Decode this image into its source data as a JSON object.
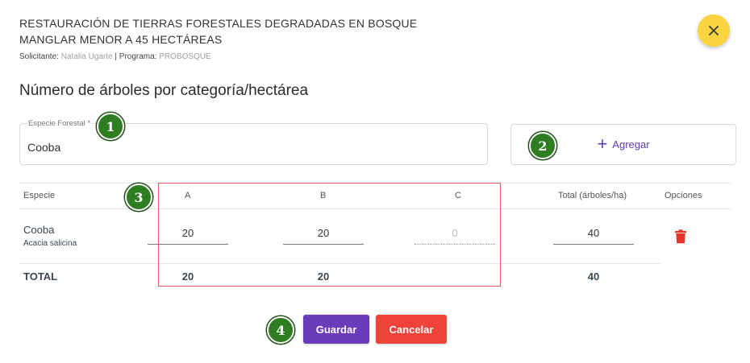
{
  "header": {
    "title": "RESTAURACIÓN DE TIERRAS FORESTALES DEGRADADAS EN BOSQUE MANGLAR MENOR A 45 HECTÁREAS",
    "applicant_label": "Solicitante: ",
    "applicant": "Natalia Ugarte",
    "separator": " | Programa: ",
    "program": "PROBOSQUE",
    "close_icon": "close-icon"
  },
  "section": {
    "heading": "Número de árboles por categoría/hectárea"
  },
  "species_field": {
    "label": "Especie Forestal *",
    "value": "Cooba"
  },
  "add_button": {
    "icon": "plus-icon",
    "label": "Agregar"
  },
  "table": {
    "headers": {
      "species": "Especie",
      "a": "A",
      "b": "B",
      "c": "C",
      "total": "Total (árboles/ha)",
      "options": "Opciones"
    },
    "rows": [
      {
        "name": "Cooba",
        "scientific": "Acacia salicina",
        "a": "20",
        "b": "20",
        "c": "0",
        "total": "40",
        "delete_icon": "trash-icon"
      }
    ],
    "totals": {
      "label": "TOTAL",
      "a": "20",
      "b": "20",
      "total": "40"
    }
  },
  "actions": {
    "save": "Guardar",
    "cancel": "Cancelar"
  },
  "badges": [
    "1",
    "2",
    "3",
    "4"
  ],
  "colors": {
    "accent": "#6a3cbc",
    "danger": "#f0433a",
    "close_bg": "#fbd440",
    "badge": "#2e7d21",
    "highlight_box": "#e35a5a"
  }
}
